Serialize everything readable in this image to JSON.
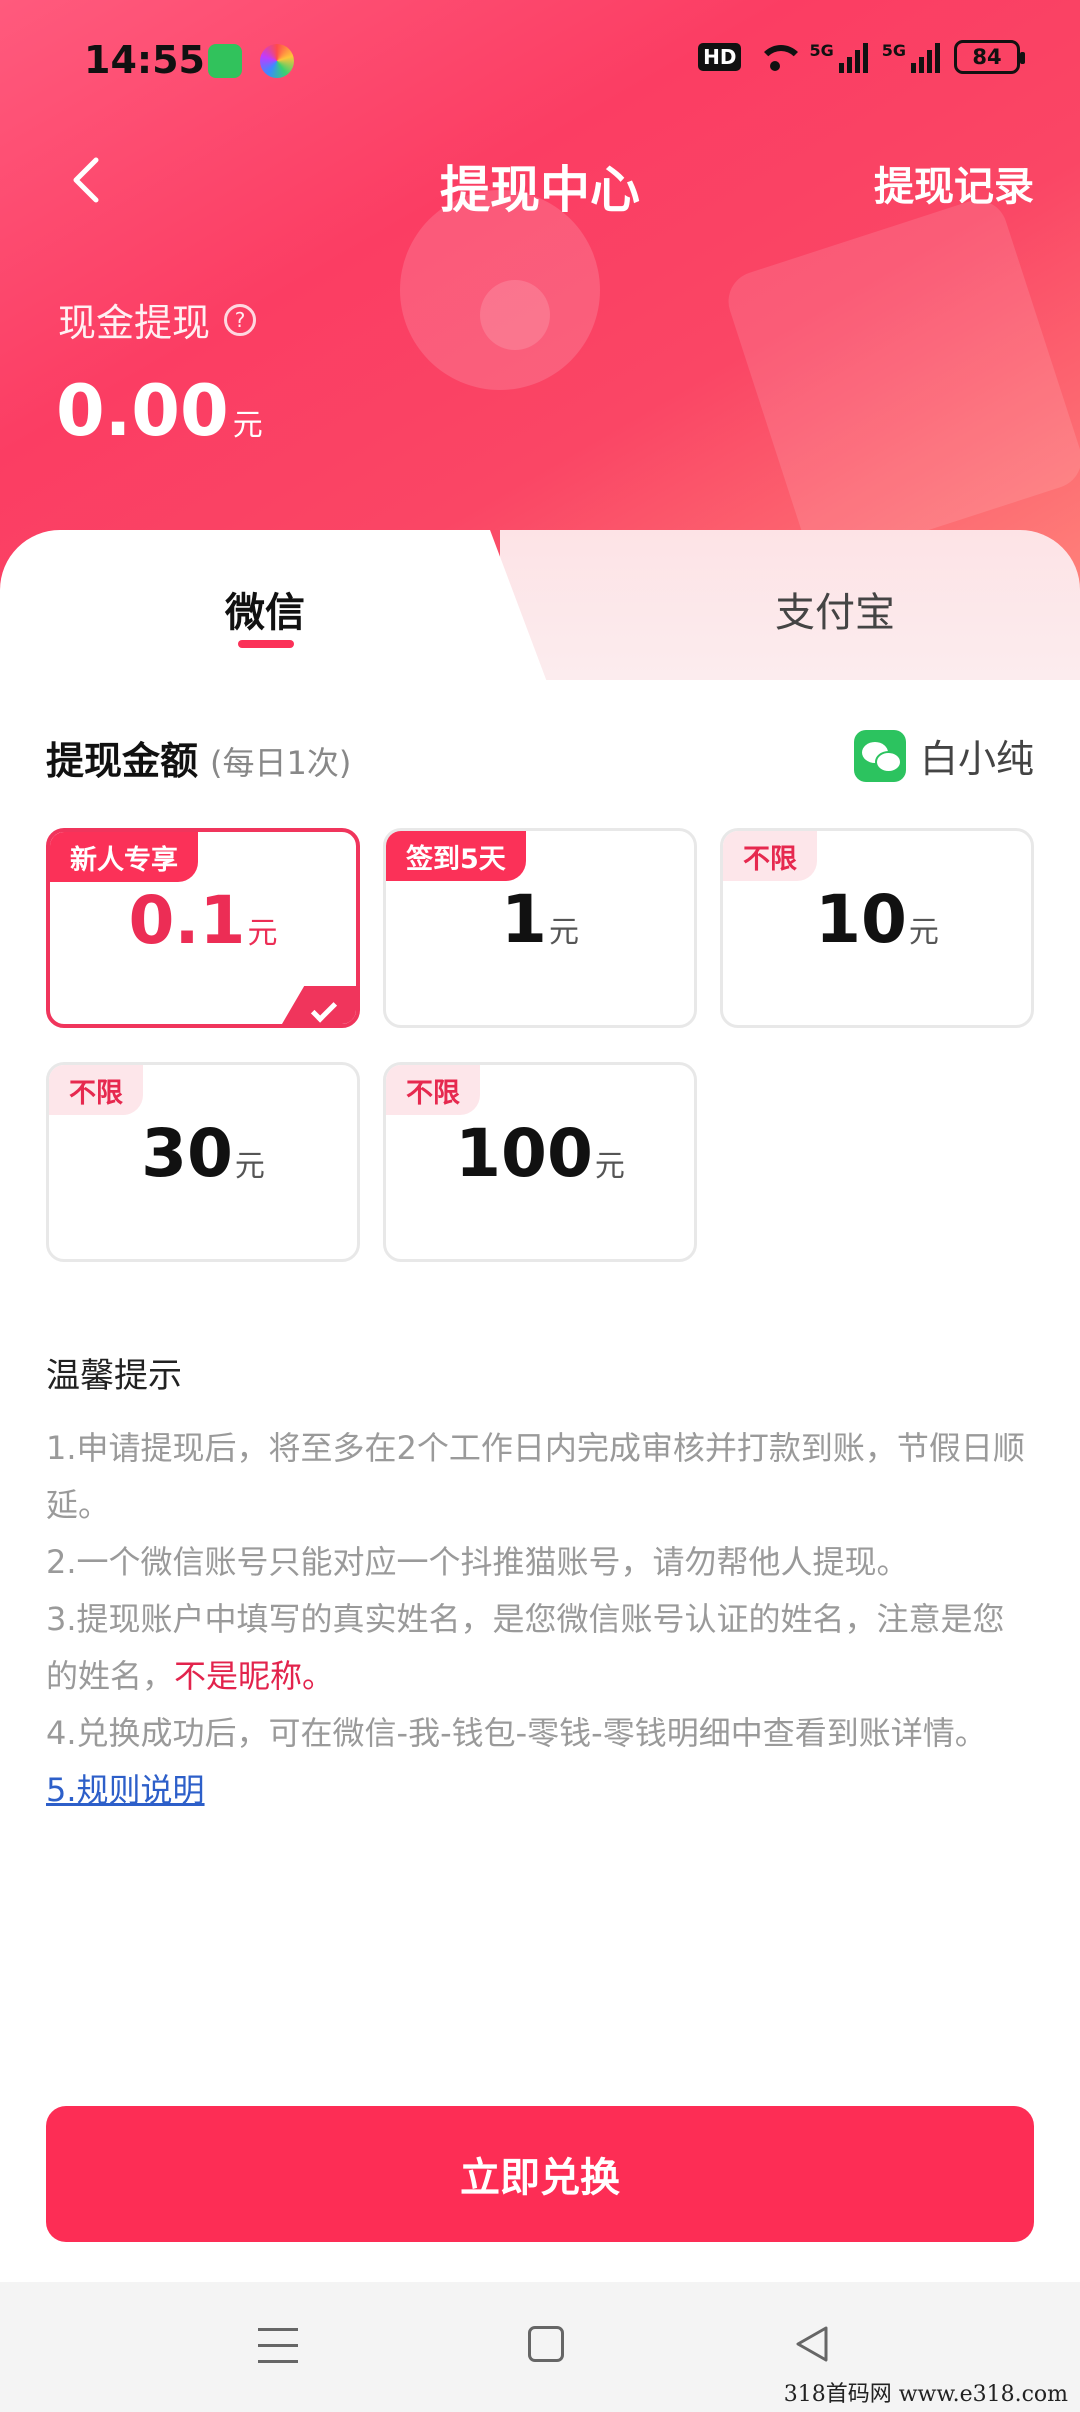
{
  "statusbar": {
    "time": "14:55",
    "hd": "HD",
    "net1": "5G",
    "net2": "5G",
    "battery": "84"
  },
  "nav": {
    "title": "提现中心",
    "record": "提现记录"
  },
  "balance": {
    "label": "现金提现",
    "help": "?",
    "amount": "0.00",
    "unit": "元"
  },
  "tabs": {
    "wechat": "微信",
    "alipay": "支付宝",
    "active": "微信"
  },
  "withdraw": {
    "title": "提现金额",
    "subtitle": "(每日1次)",
    "account_name": "白小纯",
    "options": [
      {
        "badge": "新人专享",
        "value": "0.1",
        "unit": "元",
        "selected": true
      },
      {
        "badge": "签到5天",
        "value": "1",
        "unit": "元",
        "selected": false
      },
      {
        "badge": "不限",
        "value": "10",
        "unit": "元",
        "selected": false
      },
      {
        "badge": "不限",
        "value": "30",
        "unit": "元",
        "selected": false
      },
      {
        "badge": "不限",
        "value": "100",
        "unit": "元",
        "selected": false
      }
    ]
  },
  "tips": {
    "title": "温馨提示",
    "line1": "1.申请提现后，将至多在2个工作日内完成审核并打款到账，节假日顺延。",
    "line2": "2.一个微信账号只能对应一个抖推猫账号，请勿帮他人提现。",
    "line3a": "3.提现账户中填写的真实姓名，是您微信账号认证的姓名，注意是您的姓名，",
    "line3b": "不是昵称。",
    "line4": "4.兑换成功后，可在微信-我-钱包-零钱-零钱明细中查看到账详情。",
    "line5": "5.规则说明"
  },
  "button": {
    "label": "立即兑换"
  },
  "watermark": "318首码网  www.e318.com",
  "colors": {
    "brand": "#fb3158",
    "header_gradient_start": "#ff5a7d",
    "header_gradient_end": "#ff8d7e",
    "wechat_green": "#2cc35f",
    "link": "#2d5fc9"
  }
}
